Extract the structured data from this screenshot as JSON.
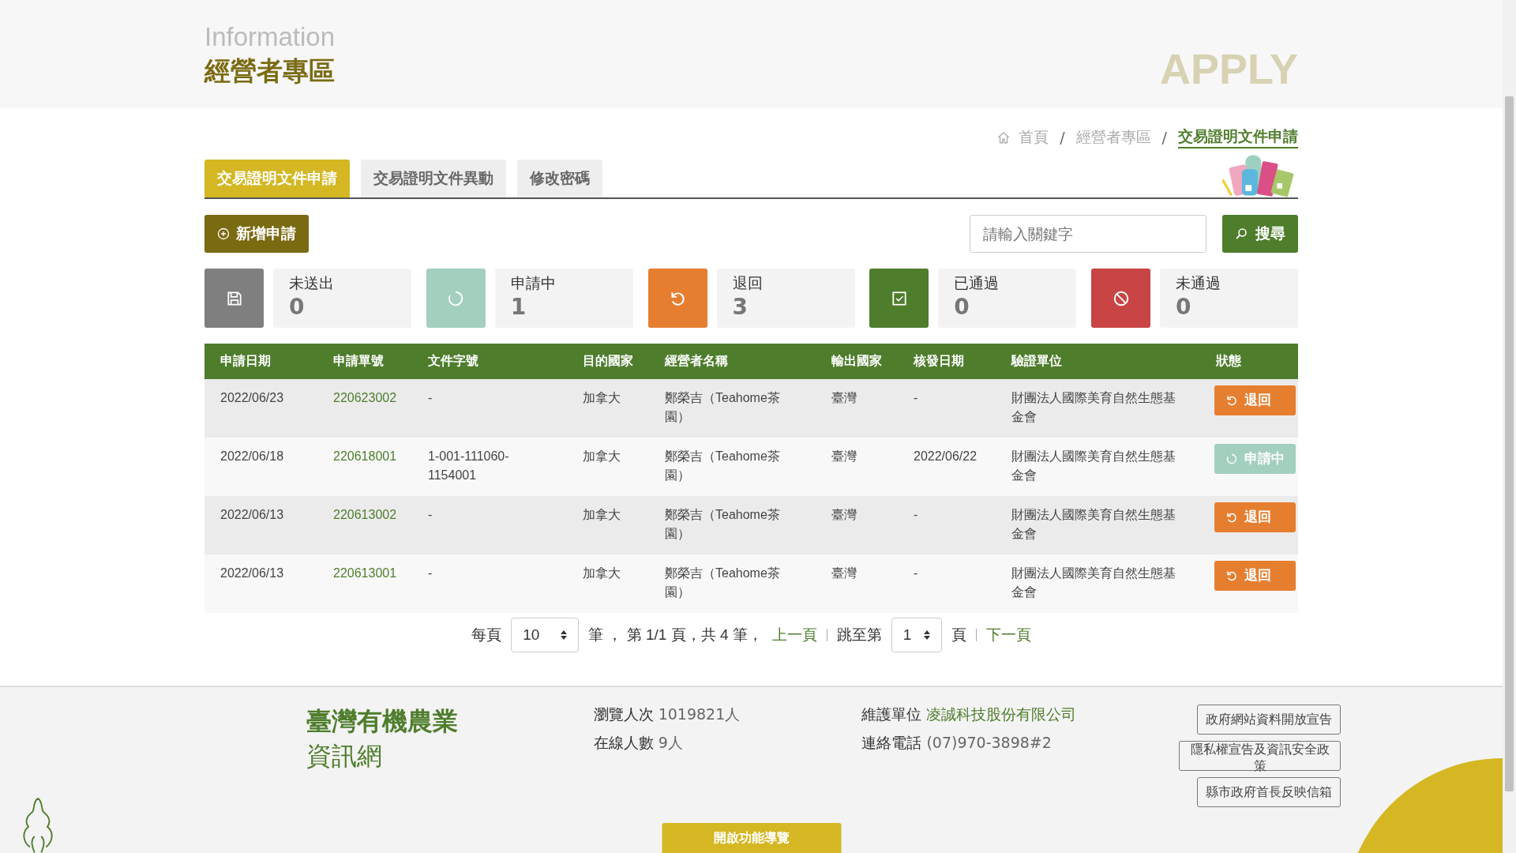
{
  "header": {
    "subtitle": "Information",
    "title": "經營者專區",
    "banner_word": "APPLY"
  },
  "breadcrumb": [
    {
      "label": "首頁",
      "current": false
    },
    {
      "label": "經營者專區",
      "current": false
    },
    {
      "label": "交易證明文件申請",
      "current": true
    }
  ],
  "breadcrumb_separators": [
    "/",
    "/"
  ],
  "tabs": [
    {
      "label": "交易證明文件申請",
      "selected": true
    },
    {
      "label": "交易證明文件異動",
      "selected": false
    },
    {
      "label": "修改密碼",
      "selected": false
    }
  ],
  "new_button": "新增申請",
  "search": {
    "placeholder": "請輸入關鍵字",
    "button": "搜尋"
  },
  "stats": [
    {
      "kind": "draft",
      "color": "#7f7f7f",
      "label": "未送出",
      "count": "0"
    },
    {
      "kind": "pending",
      "color": "#a3cfbf",
      "label": "申請中",
      "count": "1"
    },
    {
      "kind": "returned",
      "color": "#e67e30",
      "label": "退回",
      "count": "3"
    },
    {
      "kind": "approved",
      "color": "#4e7d2c",
      "label": "已通過",
      "count": "0"
    },
    {
      "kind": "rejected",
      "color": "#c94444",
      "label": "未通過",
      "count": "0"
    }
  ],
  "table": {
    "columns": [
      "申請日期",
      "申請單號",
      "文件字號",
      "目的國家",
      "經營者名稱",
      "輸出國家",
      "核發日期",
      "驗證單位",
      "狀態"
    ],
    "rows": [
      {
        "date": "2022/06/23",
        "number": "220623002",
        "doc_no": "-",
        "destination": "加拿大",
        "operator": "鄭榮吉（Teahome茶園）",
        "origin": "臺灣",
        "issue_date": "-",
        "certifier": "財團法人國際美育自然生態基金會",
        "status": {
          "kind": "returned",
          "label": "退回"
        }
      },
      {
        "date": "2022/06/18",
        "number": "220618001",
        "doc_no": "1-001-111060-1154001",
        "destination": "加拿大",
        "operator": "鄭榮吉（Teahome茶園）",
        "origin": "臺灣",
        "issue_date": "2022/06/22",
        "certifier": "財團法人國際美育自然生態基金會",
        "status": {
          "kind": "pending",
          "label": "申請中"
        }
      },
      {
        "date": "2022/06/13",
        "number": "220613002",
        "doc_no": "-",
        "destination": "加拿大",
        "operator": "鄭榮吉（Teahome茶園）",
        "origin": "臺灣",
        "issue_date": "-",
        "certifier": "財團法人國際美育自然生態基金會",
        "status": {
          "kind": "returned",
          "label": "退回"
        }
      },
      {
        "date": "2022/06/13",
        "number": "220613001",
        "doc_no": "-",
        "destination": "加拿大",
        "operator": "鄭榮吉（Teahome茶園）",
        "origin": "臺灣",
        "issue_date": "-",
        "certifier": "財團法人國際美育自然生態基金會",
        "status": {
          "kind": "returned",
          "label": "退回"
        }
      }
    ]
  },
  "pagination": {
    "per_page_label": "每頁",
    "per_page": "10",
    "summary": "筆 ， 第 1/1 頁，共 4 筆，",
    "prev": "上一頁",
    "jump_label": "跳至第",
    "page": "1",
    "page_suffix": "頁",
    "next": "下一頁"
  },
  "footer": {
    "site_name": "臺灣有機農業",
    "site_name_2": "資訊網",
    "visits_label": "瀏覽人次",
    "visits": "1019821人",
    "online_label": "在線人數",
    "online": "9人",
    "maintainer_label": "維護單位",
    "maintainer": "凌誠科技股份有限公司",
    "phone_label": "連絡電話",
    "phone": "(07)970-3898#2",
    "links": [
      "政府網站資料開放宣告",
      "隱私權宣告及資訊安全政策",
      "縣市政府首長反映信箱"
    ],
    "guide_button": "開啟功能導覽"
  }
}
